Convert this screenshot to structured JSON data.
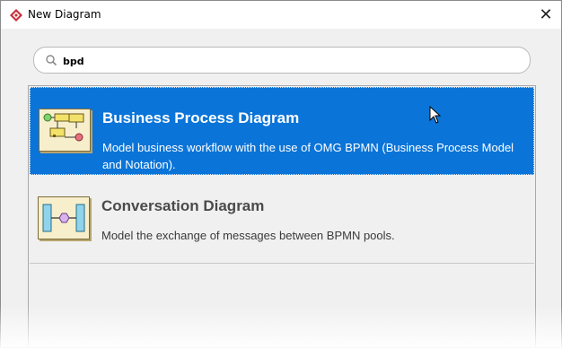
{
  "window": {
    "title": "New Diagram",
    "app_icon": "diamond-logo-icon",
    "close_icon": "close-icon",
    "close_glyph": "✕"
  },
  "search": {
    "value": "bpd",
    "icon": "search-icon"
  },
  "diagrams": [
    {
      "name": "Business Process Diagram",
      "description": "Model business workflow with the use of OMG BPMN (Business Process Model and Notation).",
      "selected": true,
      "icon": "business-process-diagram-icon"
    },
    {
      "name": "Conversation Diagram",
      "description": "Model the exchange of messages between BPMN pools.",
      "selected": false,
      "icon": "conversation-diagram-icon"
    }
  ],
  "colors": {
    "selection": "#0a74d8",
    "accent_red": "#c8303a"
  }
}
